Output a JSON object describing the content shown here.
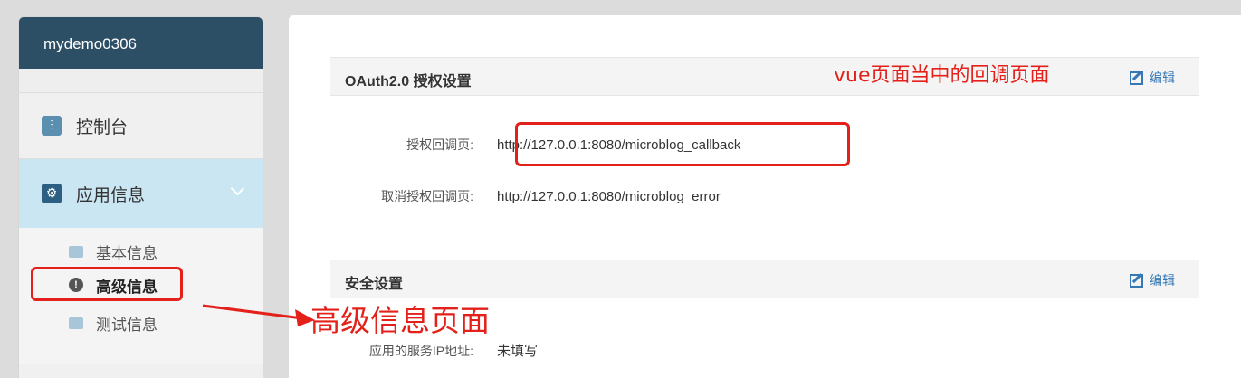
{
  "sidebar": {
    "app_name": "mydemo0306",
    "items": [
      {
        "label": "控制台",
        "icon": "sliders-icon"
      },
      {
        "label": "应用信息",
        "icon": "gear-icon"
      }
    ],
    "sub_items": [
      {
        "label": "基本信息",
        "icon": "id-card-icon"
      },
      {
        "label": "高级信息",
        "icon": "exclamation-icon"
      },
      {
        "label": "测试信息",
        "icon": "test-card-icon"
      }
    ]
  },
  "oauth_section": {
    "title": "OAuth2.0 授权设置",
    "edit_label": "编辑",
    "rows": [
      {
        "label": "授权回调页:",
        "value": "http://127.0.0.1:8080/microblog_callback"
      },
      {
        "label": "取消授权回调页:",
        "value": "http://127.0.0.1:8080/microblog_error"
      }
    ]
  },
  "security_section": {
    "title": "安全设置",
    "edit_label": "编辑",
    "rows": [
      {
        "label": "应用的服务IP地址:",
        "value": "未填写"
      }
    ]
  },
  "annotations": {
    "callback_note": "vue页面当中的回调页面",
    "advanced_note": "高级信息页面",
    "color": "#e3201a"
  }
}
